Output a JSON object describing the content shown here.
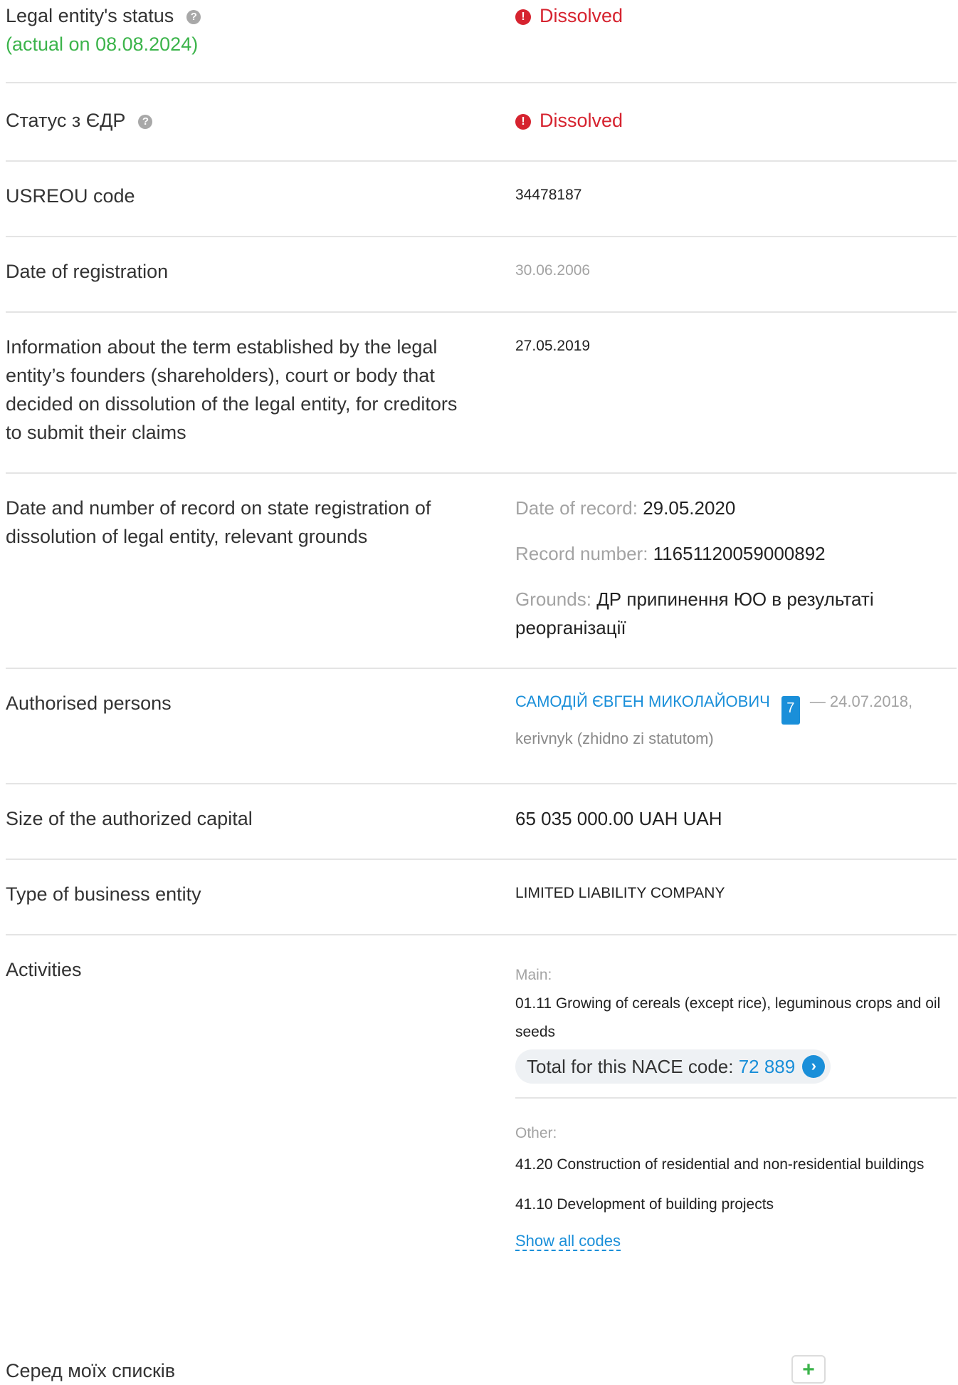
{
  "rows": {
    "status": {
      "label": "Legal entity's status",
      "note": "(actual on 08.08.2024)",
      "value": "Dissolved"
    },
    "edr_status": {
      "label": "Статус з ЄДР",
      "value": "Dissolved"
    },
    "usreou": {
      "label": "USREOU code",
      "value": "34478187"
    },
    "registration": {
      "label": "Date of registration",
      "value": "30.06.2006"
    },
    "term_info": {
      "label": "Information about the term established by the legal entity’s founders (shareholders), court or body that decided on dissolution of the legal entity, for creditors to submit their claims",
      "value": "27.05.2019"
    },
    "dissolution_record": {
      "label": "Date and number of record on state registration of dissolution of legal entity, relevant grounds",
      "date_label": "Date of record:",
      "date_value": "29.05.2020",
      "number_label": "Record number:",
      "number_value": "11651120059000892",
      "grounds_label": "Grounds:",
      "grounds_value": "ДР припинення ЮО в результаті реорганізації"
    },
    "authorised": {
      "label": "Authorised persons",
      "person_name": "САМОДІЙ ЄВГЕН МИКОЛАЙОВИЧ",
      "person_count": "7",
      "person_date": "— 24.07.2018,",
      "person_role": "kerivnyk (zhidno zi statutom)"
    },
    "capital": {
      "label": "Size of the authorized capital",
      "value": "65 035 000.00 UAH UAH"
    },
    "business_type": {
      "label": "Type of business entity",
      "value": "LIMITED LIABILITY COMPANY"
    },
    "activities": {
      "label": "Activities",
      "main_label": "Main:",
      "main_code": "01.11 Growing of cereals (except rice), leguminous crops and oil seeds",
      "total_label": "Total for this NACE code:",
      "total_value": "72 889",
      "other_label": "Other:",
      "other_codes": [
        "41.20 Construction of residential and non-residential buildings",
        "41.10 Development of building projects"
      ],
      "show_all": "Show all codes"
    },
    "lists": {
      "label": "Серед моїх списків",
      "add": "+"
    }
  },
  "colors": {
    "accent": "#1a8fd9",
    "danger": "#d6232f",
    "success": "#3cb44b",
    "muted": "#a3a3a3"
  }
}
